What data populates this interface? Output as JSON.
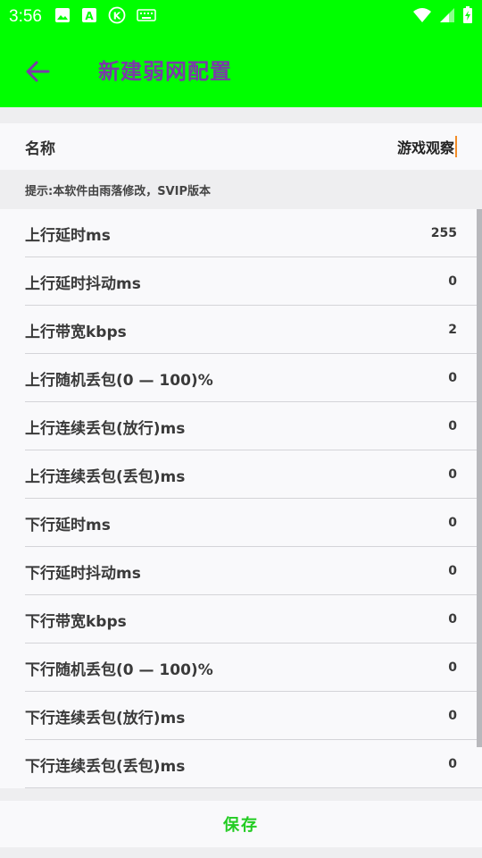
{
  "status_bar": {
    "time": "3:56",
    "left_icons": [
      "image-icon",
      "a-box-icon",
      "k-circle-icon",
      "keyboard-icon"
    ],
    "right_icons": [
      "wifi-icon",
      "signal-icon",
      "battery-icon"
    ]
  },
  "toolbar": {
    "title": "新建弱网配置",
    "bg_color": "#00ff00",
    "title_color": "#7a3aa8"
  },
  "name_field": {
    "label": "名称",
    "value": "游戏观察"
  },
  "hint": "提示:本软件由雨落修改，SVIP版本",
  "items": [
    {
      "label": "上行延时ms",
      "value": "255"
    },
    {
      "label": "上行延时抖动ms",
      "value": "0"
    },
    {
      "label": "上行带宽kbps",
      "value": "2"
    },
    {
      "label": "上行随机丢包(0 — 100)%",
      "value": "0"
    },
    {
      "label": "上行连续丢包(放行)ms",
      "value": "0"
    },
    {
      "label": "上行连续丢包(丢包)ms",
      "value": "0"
    },
    {
      "label": "下行延时ms",
      "value": "0"
    },
    {
      "label": "下行延时抖动ms",
      "value": "0"
    },
    {
      "label": "下行带宽kbps",
      "value": "0"
    },
    {
      "label": "下行随机丢包(0 — 100)%",
      "value": "0"
    },
    {
      "label": "下行连续丢包(放行)ms",
      "value": "0"
    },
    {
      "label": "下行连续丢包(丢包)ms",
      "value": "0"
    }
  ],
  "save_label": "保存",
  "save_color": "#22cc22"
}
